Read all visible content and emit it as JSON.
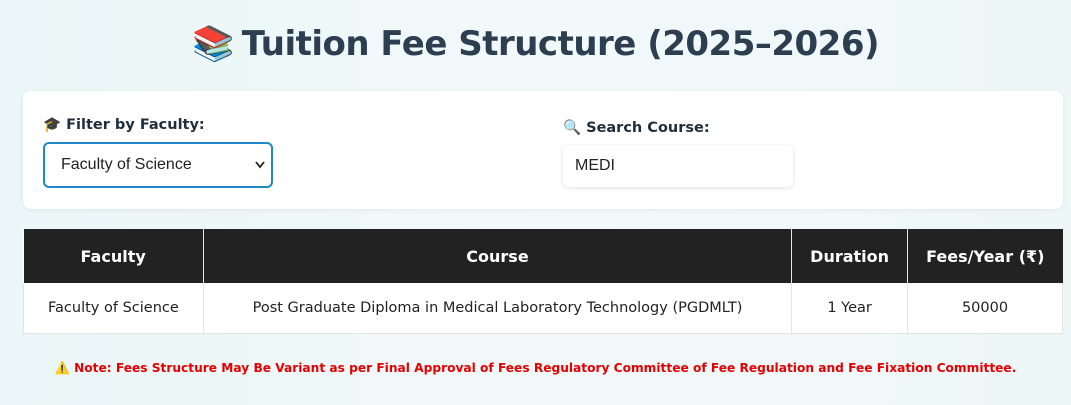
{
  "page": {
    "title_icon": "📚",
    "title": "Tuition Fee Structure (2025–2026)"
  },
  "filters": {
    "faculty_icon": "🎓",
    "faculty_label": "Filter by Faculty:",
    "faculty_selected": "Faculty of Science",
    "search_icon": "🔍",
    "search_label": "Search Course:",
    "search_value": "MEDI"
  },
  "table": {
    "headers": [
      "Faculty",
      "Course",
      "Duration",
      "Fees/Year (₹)"
    ],
    "rows": [
      {
        "faculty": "Faculty of Science",
        "course": "Post Graduate Diploma in Medical Laboratory Technology (PGDMLT)",
        "duration": "1 Year",
        "fees": "50000"
      }
    ]
  },
  "note": {
    "icon": "⚠️",
    "text": "Note: Fees Structure May Be Variant as per Final Approval of Fees Regulatory Committee of Fee Regulation and Fee Fixation Committee."
  },
  "colors": {
    "accent": "#1e88c8",
    "header_bg": "#222222",
    "note_red": "#e60000"
  }
}
